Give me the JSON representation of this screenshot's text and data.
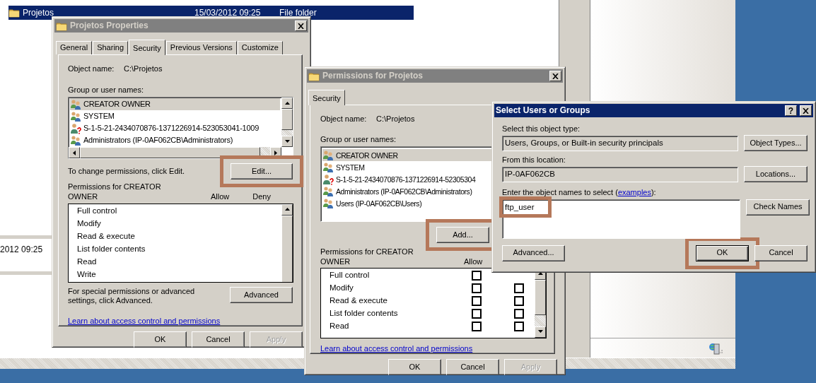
{
  "explorer": {
    "rows": [
      {
        "name": "Projetos",
        "date": "15/03/2012 09:25",
        "type": "File folder",
        "selected": true
      }
    ],
    "lower_pane_date": "2012 09:25"
  },
  "properties_dialog": {
    "title": "Projetos Properties",
    "active": false,
    "tabs": [
      {
        "label": "General",
        "selected": false
      },
      {
        "label": "Sharing",
        "selected": false
      },
      {
        "label": "Security",
        "selected": true
      },
      {
        "label": "Previous Versions",
        "selected": false
      },
      {
        "label": "Customize",
        "selected": false
      }
    ],
    "object_name_label": "Object name:",
    "object_name": "C:\\Projetos",
    "group_label": "Group or user names:",
    "principals": [
      {
        "name": "CREATOR OWNER",
        "kind": "group",
        "selected": true
      },
      {
        "name": "SYSTEM",
        "kind": "group",
        "selected": false
      },
      {
        "name": "S-1-5-21-2434070876-1371226914-523053041-1009",
        "kind": "unknown",
        "selected": false
      },
      {
        "name": "Administrators (IP-0AF062CB\\Administrators)",
        "kind": "group",
        "selected": false
      }
    ],
    "edit_hint": "To change permissions, click Edit.",
    "edit_button": {
      "label": "Edit...",
      "highlighted": true
    },
    "permissions_label": "Permissions for CREATOR OWNER",
    "allow_header": "Allow",
    "deny_header": "Deny",
    "permissions": [
      {
        "name": "Full control"
      },
      {
        "name": "Modify"
      },
      {
        "name": "Read & execute"
      },
      {
        "name": "List folder contents"
      },
      {
        "name": "Read"
      },
      {
        "name": "Write"
      }
    ],
    "advanced_hint": "For special permissions or advanced settings, click Advanced.",
    "advanced_button": {
      "label": "Advanced",
      "highlighted": false
    },
    "help_link": "Learn about access control and permissions",
    "buttons": [
      {
        "label": "OK",
        "disabled": false
      },
      {
        "label": "Cancel",
        "disabled": false
      },
      {
        "label": "Apply",
        "disabled": true
      }
    ]
  },
  "permissions_dialog": {
    "title": "Permissions for Projetos",
    "active": false,
    "tabs": [
      {
        "label": "Security",
        "selected": true
      }
    ],
    "object_name_label": "Object name:",
    "object_name": "C:\\Projetos",
    "group_label": "Group or user names:",
    "principals": [
      {
        "name": "CREATOR OWNER",
        "kind": "group",
        "selected": true
      },
      {
        "name": "SYSTEM",
        "kind": "group",
        "selected": false
      },
      {
        "name": "S-1-5-21-2434070876-1371226914-52305304",
        "kind": "unknown",
        "selected": false
      },
      {
        "name": "Administrators (IP-0AF062CB\\Administrators)",
        "kind": "group",
        "selected": false
      },
      {
        "name": "Users (IP-0AF062CB\\Users)",
        "kind": "group",
        "selected": false
      }
    ],
    "add_button": {
      "label": "Add...",
      "highlighted": true
    },
    "permissions_label": "Permissions for CREATOR OWNER",
    "allow_header": "Allow",
    "permissions": [
      {
        "name": "Full control",
        "allow": false
      },
      {
        "name": "Modify",
        "allow": false,
        "deny": false
      },
      {
        "name": "Read & execute",
        "allow": false,
        "deny": false
      },
      {
        "name": "List folder contents",
        "allow": false,
        "deny": false
      },
      {
        "name": "Read",
        "allow": false,
        "deny": false
      }
    ],
    "help_link": "Learn about access control and permissions",
    "buttons": [
      {
        "label": "OK",
        "disabled": false
      },
      {
        "label": "Cancel",
        "disabled": false
      },
      {
        "label": "Apply",
        "disabled": true
      }
    ]
  },
  "select_dialog": {
    "title": "Select Users or Groups",
    "active": true,
    "help_button": "?",
    "object_type_label": "Select this object type:",
    "object_type": "Users, Groups, or Built-in security principals",
    "object_types_button": "Object Types...",
    "location_label": "From this location:",
    "location": "IP-0AF062CB",
    "locations_button": "Locations...",
    "names_label_before": "Enter the object names to select (",
    "examples_link": "examples",
    "names_label_after": "):",
    "names_field": {
      "value": "ftp_user",
      "highlighted": true
    },
    "check_names_button": "Check Names",
    "advanced_button": "Advanced...",
    "buttons": [
      {
        "label": "OK",
        "default": true,
        "highlighted": true
      },
      {
        "label": "Cancel",
        "default": false,
        "highlighted": false
      }
    ]
  }
}
